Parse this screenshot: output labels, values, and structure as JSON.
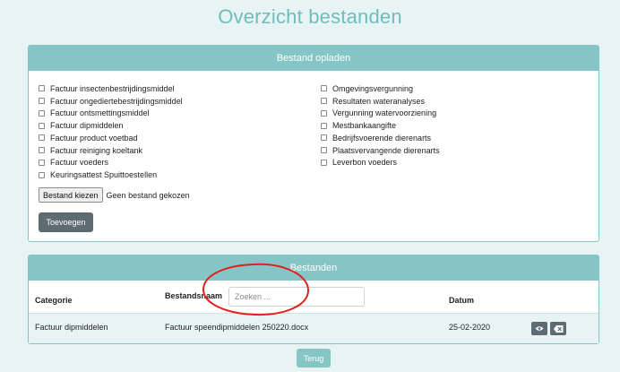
{
  "page_title": "Overzicht bestanden",
  "upload": {
    "header": "Bestand opladen",
    "left_options": [
      "Factuur insectenbestrijdingsmiddel",
      "Factuur ongediertebestrijdingsmiddel",
      "Factuur ontsmettingsmiddel",
      "Factuur dipmiddelen",
      "Factuur product voetbad",
      "Factuur reiniging koeltank",
      "Factuur voeders",
      "Keuringsattest Spuittoestellen"
    ],
    "right_options": [
      "Omgevingsvergunning",
      "Resultaten wateranalyses",
      "Vergunning watervoorziening",
      "Mestbankaangifte",
      "Bedrijfsvoerende dierenarts",
      "Plaatsvervangende dierenarts",
      "Leverbon voeders"
    ],
    "file_button": "Bestand kiezen",
    "file_status": "Geen bestand gekozen",
    "add_button": "Toevoegen"
  },
  "files": {
    "header": "Bestanden",
    "columns": {
      "category": "Categorie",
      "filename": "Bestandsnaam",
      "date": "Datum"
    },
    "search_placeholder": "Zoeken ...",
    "rows": [
      {
        "category": "Factuur dipmiddelen",
        "filename": "Factuur speendipmiddelen 250220.docx",
        "date": "25-02-2020"
      }
    ]
  },
  "back_button": "Terug",
  "icons": {
    "view": "eye-icon",
    "delete": "backspace-delete-icon",
    "annotation": "red-ellipse-annotation"
  },
  "colors": {
    "accent": "#86c5c6",
    "title": "#6fbcbd",
    "background": "#e8f4f3",
    "dark_button": "#5f6b73",
    "annotation": "#e0201b"
  }
}
